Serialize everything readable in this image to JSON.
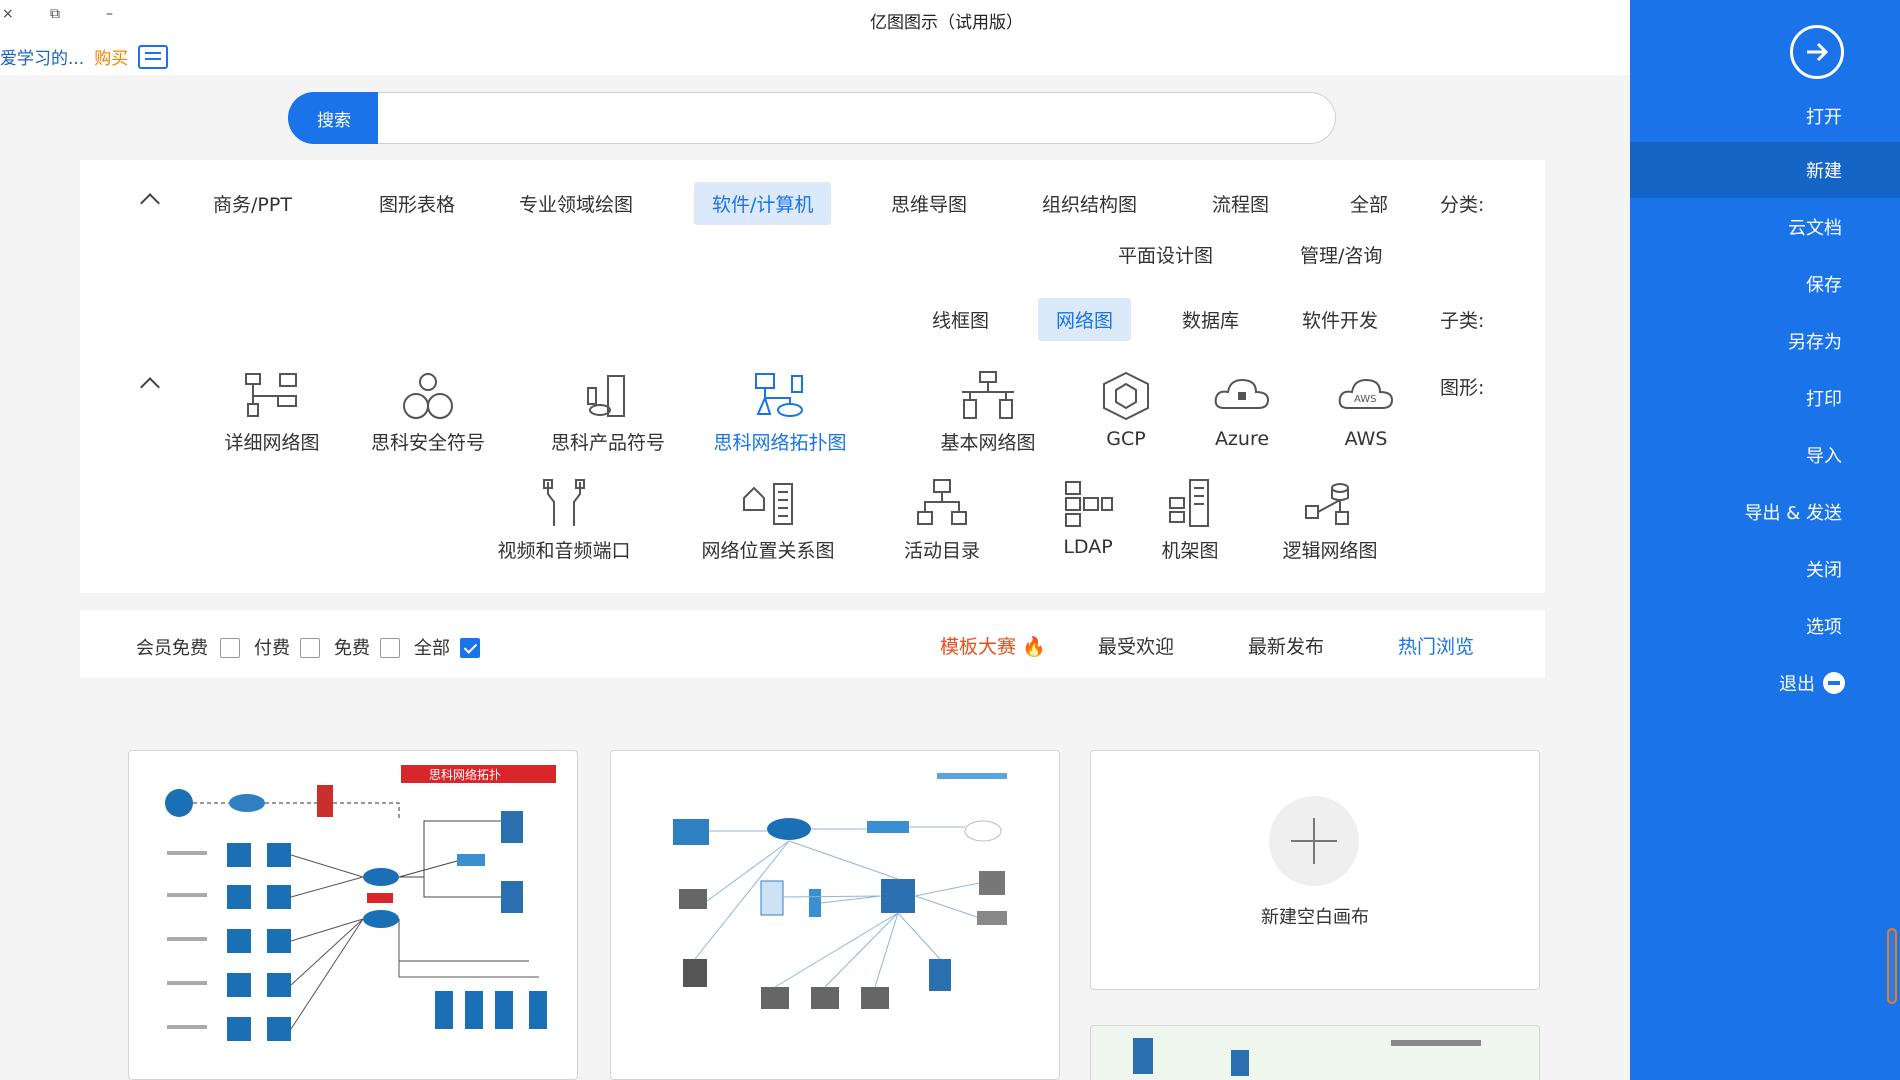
{
  "window": {
    "title": "亿图图示（试用版）",
    "close_glyph": "×",
    "restore_glyph": "⧉",
    "min_glyph": "–"
  },
  "toplinks": {
    "study": "爱学习的...",
    "buy": "购买"
  },
  "search": {
    "button": "搜索",
    "placeholder": ""
  },
  "sidebar": {
    "open": "打开",
    "items": [
      {
        "label": "新建",
        "active": true
      },
      {
        "label": "云文档"
      },
      {
        "label": "保存"
      },
      {
        "label": "另存为"
      },
      {
        "label": "打印"
      },
      {
        "label": "导入"
      },
      {
        "label": "导出 & 发送"
      },
      {
        "label": "关闭"
      },
      {
        "label": "选项"
      },
      {
        "label": "退出"
      }
    ]
  },
  "category": {
    "label": "分类:",
    "items": [
      "全部",
      "流程图",
      "组织结构图",
      "思维导图",
      "软件/计算机",
      "专业领域绘图",
      "图形表格",
      "商务/PPT",
      "管理/咨询",
      "平面设计图"
    ],
    "active": "软件/计算机"
  },
  "subcategory": {
    "label": "子类:",
    "items": [
      "软件开发",
      "数据库",
      "网络图",
      "线框图"
    ],
    "active": "网络图"
  },
  "shapes": {
    "label": "图形:",
    "items": [
      {
        "label": "AWS",
        "icon": "aws-cloud-icon"
      },
      {
        "label": "Azure",
        "icon": "azure-cloud-icon"
      },
      {
        "label": "GCP",
        "icon": "gcp-hexagon-icon"
      },
      {
        "label": "基本网络图",
        "icon": "basic-network-icon"
      },
      {
        "label": "思科网络拓扑图",
        "icon": "cisco-topology-icon",
        "active": true
      },
      {
        "label": "思科产品符号",
        "icon": "cisco-product-icon"
      },
      {
        "label": "思科安全符号",
        "icon": "cisco-security-icon"
      },
      {
        "label": "详细网络图",
        "icon": "detailed-network-icon"
      },
      {
        "label": "逻辑网络图",
        "icon": "logical-network-icon"
      },
      {
        "label": "机架图",
        "icon": "rack-icon"
      },
      {
        "label": "LDAP",
        "icon": "ldap-icon"
      },
      {
        "label": "活动目录",
        "icon": "active-directory-icon"
      },
      {
        "label": "网络位置关系图",
        "icon": "network-location-icon"
      },
      {
        "label": "视频和音频端口",
        "icon": "av-port-icon"
      }
    ]
  },
  "filters": {
    "tabs": [
      "热门浏览",
      "最新发布",
      "最受欢迎",
      "模板大赛"
    ],
    "active": "热门浏览",
    "checks": [
      {
        "label": "全部",
        "checked": true
      },
      {
        "label": "免费",
        "checked": false
      },
      {
        "label": "付费",
        "checked": false
      },
      {
        "label": "会员免费",
        "checked": false
      }
    ]
  },
  "cards": {
    "new_blank": "新建空白画布",
    "template_title": "思科网络拓扑"
  },
  "colors": {
    "accent": "#1a73e8",
    "contest": "#e8501a",
    "buy": "#f08300",
    "template_banner": "#d9262b"
  }
}
